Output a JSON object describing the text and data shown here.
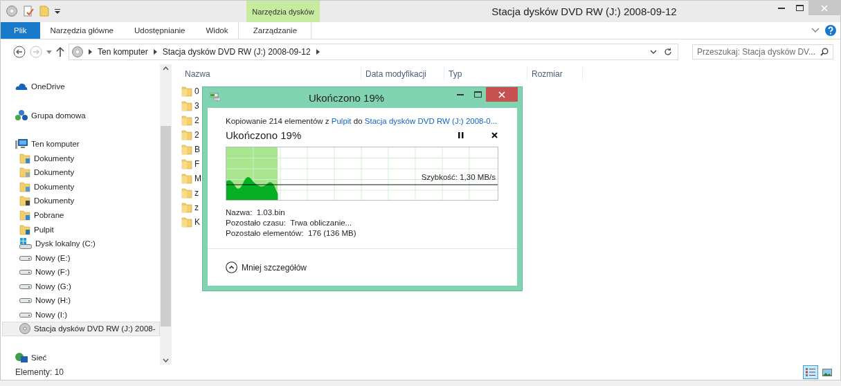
{
  "window": {
    "title": "Stacja dysków DVD RW (J:) 2008-09-12"
  },
  "context_tab_group": {
    "label": "Narzędzia dysków"
  },
  "ribbon_tabs": [
    {
      "label": "Plik",
      "kind": "file"
    },
    {
      "label": "Narzędzia główne",
      "kind": "tab"
    },
    {
      "label": "Udostępnianie",
      "kind": "tab"
    },
    {
      "label": "Widok",
      "kind": "tab"
    },
    {
      "label": "Zarządzanie",
      "kind": "context"
    }
  ],
  "address_bar": {
    "segments": [
      "Ten komputer",
      "Stacja dysków DVD RW (J:) 2008-09-12"
    ]
  },
  "search": {
    "placeholder": "Przeszukaj: Stacja dysków DV..."
  },
  "navigation": [
    {
      "label": "OneDrive",
      "kind": "cloud",
      "selected": false
    },
    {
      "label": "Grupa domowa",
      "kind": "homegroup",
      "selected": false
    },
    {
      "label": "Ten komputer",
      "kind": "computer",
      "selected": false,
      "children": [
        {
          "label": "Dokumenty",
          "kind": "folder-music",
          "selected": false
        },
        {
          "label": "Dokumenty",
          "kind": "folder-docs",
          "selected": false
        },
        {
          "label": "Dokumenty",
          "kind": "folder-pictures",
          "selected": false
        },
        {
          "label": "Dokumenty",
          "kind": "folder-video",
          "selected": false
        },
        {
          "label": "Pobrane",
          "kind": "folder-download",
          "selected": false
        },
        {
          "label": "Pulpit",
          "kind": "folder-desktop",
          "selected": false
        },
        {
          "label": "Dysk lokalny (C:)",
          "kind": "drive-system",
          "selected": false
        },
        {
          "label": "Nowy (E:)",
          "kind": "drive",
          "selected": false
        },
        {
          "label": "Nowy (F:)",
          "kind": "drive",
          "selected": false
        },
        {
          "label": "Nowy (G:)",
          "kind": "drive",
          "selected": false
        },
        {
          "label": "Nowy (H:)",
          "kind": "drive",
          "selected": false
        },
        {
          "label": "Nowy (I:)",
          "kind": "drive",
          "selected": false
        },
        {
          "label": "Stacja dysków DVD RW (J:) 2008-",
          "kind": "dvd",
          "selected": true
        }
      ]
    },
    {
      "label": "Sieć",
      "kind": "network",
      "selected": false
    }
  ],
  "columns": [
    "Nazwa",
    "Data modyfikacji",
    "Typ",
    "Rozmiar"
  ],
  "files": [
    "0",
    "3",
    "2",
    "2",
    "B",
    "F",
    "M",
    "z",
    "z",
    "K"
  ],
  "status_bar": {
    "count": "Elementy: 10",
    "views": [
      {
        "kind": "details",
        "selected": true
      },
      {
        "kind": "thumbnails",
        "selected": false
      }
    ]
  },
  "copy_dialog": {
    "title": "Ukończono 19%",
    "summary": "Kopiowanie 214 elementów z ",
    "source": "Pulpit",
    "joiner": " do ",
    "destination": "Stacja dysków DVD RW (J:) 2008-0...",
    "heading": "Ukończono 19%",
    "level": 0.19,
    "speed": "Szybkość: 1,30 MB/s",
    "details": [
      {
        "label": "Nazwa:",
        "value": "1.03.bin"
      },
      {
        "label": "Pozostało czasu:",
        "value": "Trwa obliczanie..."
      },
      {
        "label": "Pozostało elementów:",
        "value": "176 (136 MB)"
      }
    ],
    "toggle": "Mniej szczegółów"
  }
}
